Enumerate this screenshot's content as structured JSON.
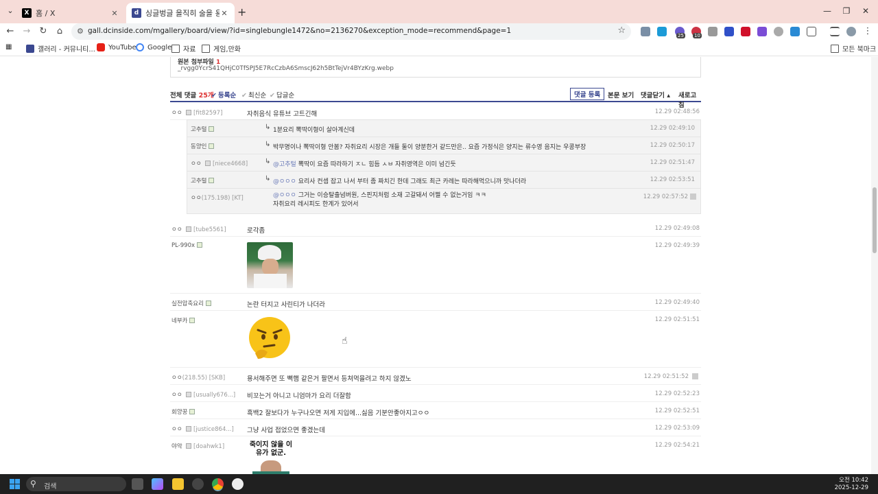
{
  "browser": {
    "tabs": [
      {
        "title": "홈 / X",
        "active": false
      },
      {
        "title": "싱글벙글 을직히 술을 용서해주...",
        "active": true
      }
    ],
    "url": "gall.dcinside.com/mgallery/board/view/?id=singlebungle1472&no=2136270&exception_mode=recommend&page=1",
    "extension_badges": [
      "25",
      "10"
    ],
    "bookmarks": [
      "갤러리 - 커뮤니티...",
      "YouTube",
      "Google",
      "자료",
      "게임,만화"
    ],
    "all_bookmarks": "모든 북마크"
  },
  "attachment": {
    "label": "원본 첨부파일",
    "count": "1",
    "filename": "_rvgg0YcrS41QHjC0TfSPJ5E7RcCzbA6SmscJ62h5BtTejVr4BYzKrg.webp"
  },
  "comments_header": {
    "total_label": "전체 댓글",
    "total_count": "25개",
    "sort_registered": "등록순",
    "sort_latest": "최신순",
    "sort_replies": "답글순",
    "register_button": "댓글 등록",
    "view_body": "본문 보기",
    "collapse": "댓글닫기 ▴",
    "refresh": "새로고침"
  },
  "comments": [
    {
      "nick": "ㅇㅇ",
      "ip": "[fit82597]",
      "text": "자취음식 유튜브 고트긴해",
      "time": "12.29 02:48:56"
    },
    {
      "nick": "ㅇㅇ",
      "ip": "[tube5561]",
      "text": "로각좀",
      "time": "12.29 02:49:08"
    },
    {
      "nick": "PL-990x",
      "ip": "",
      "text": "",
      "time": "12.29 02:49:39"
    },
    {
      "nick": "실전압축요리",
      "ip": "",
      "text": "논란 터지고 사린티가 나더라",
      "time": "12.29 02:49:40"
    },
    {
      "nick": "네부카",
      "ip": "",
      "text": "",
      "time": "12.29 02:51:51"
    },
    {
      "nick": "ㅇㅇ",
      "ip": "(218.55) [SKB]",
      "text": "용서해주면 또 뻑햄 같은거 팔면서 등쳐먹을려고 하지 않겠노",
      "time": "12.29 02:51:52"
    },
    {
      "nick": "ㅇㅇ",
      "ip": "[usually676...]",
      "text": "비꼬는거 아니고 니엄마가 요리 더잘함",
      "time": "12.29 02:52:23"
    },
    {
      "nick": "회양꿍",
      "ip": "",
      "text": "흑백2 잘보다가 누구나오면 저게 지입에...싫음 기분안좋아지고ㅇㅇ",
      "time": "12.29 02:52:51"
    },
    {
      "nick": "ㅇㅇ",
      "ip": "[justice864...]",
      "text": "그냥 사업 접었으면 좋겠는데",
      "time": "12.29 02:53:09"
    },
    {
      "nick": "야악",
      "ip": "[doahwk1]",
      "text": "",
      "time": "12.29 02:54:21"
    }
  ],
  "replies": [
    {
      "nick": "고추털",
      "ip": "",
      "mention": "",
      "text": "1분요리 뽁딱이형이 살아계신데",
      "time": "12.29 02:49:10"
    },
    {
      "nick": "동양인",
      "ip": "",
      "mention": "",
      "text": "박무명이나 뽁딱이형 안봄? 자취요리 시장은 개들 둘이 양분한거 같드만은.. 요즘 가정식은 양지는 류수영 음지는 우콩부장",
      "time": "12.29 02:50:17"
    },
    {
      "nick": "ㅇㅇ",
      "ip": "[niece4668]",
      "mention": "@고추털",
      "text": "뽁딱이 요즘 따라하기 ㅈㄴ 힘듬 ㅅㅂ 자취영역은 이미 넘긴듯",
      "time": "12.29 02:51:47"
    },
    {
      "nick": "고추털",
      "ip": "",
      "mention": "@ㅇㅇㅇ",
      "text": "요리사 컨셉 잡고 나서 부터 좀 짜치긴 한데 그래도 최근 카레는 따라해먹으니까 맛나더라",
      "time": "12.29 02:53:51"
    },
    {
      "nick": "ㅇㅇ",
      "ip": "(175.198) [KT]",
      "mention": "@ㅇㅇㅇ",
      "text": "그거는 이승탈출넘버원, 스핀지처럼 소재 고갈돼서 어쩔 수 없는거임 ㅋㅋ",
      "text2": "자취요리 레시피도 한계가 있어서",
      "time": "12.29 02:57:52"
    }
  ],
  "image_caption": "죽이지 않을 이유가 없군.",
  "taskbar": {
    "search_placeholder": "검색",
    "clock_time": "오전 10:42",
    "clock_date": "2025-12-29"
  }
}
